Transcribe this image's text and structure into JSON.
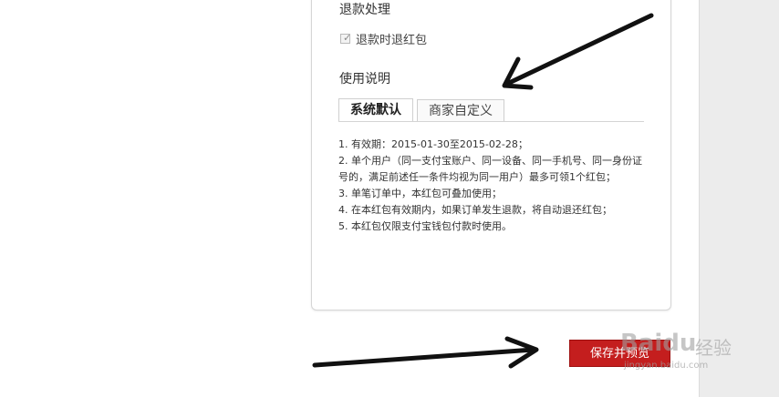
{
  "refund": {
    "title": "退款处理",
    "checkbox_label": "退款时退红包"
  },
  "usage": {
    "title": "使用说明",
    "tabs": [
      {
        "label": "系统默认"
      },
      {
        "label": "商家自定义"
      }
    ],
    "notes": [
      "1. 有效期：2015-01-30至2015-02-28；",
      "2. 单个用户（同一支付宝账户、同一设备、同一手机号、同一身份证号的，满足前述任一条件均视为同一用户）最多可领1个红包；",
      "3. 单笔订单中，本红包可叠加使用；",
      "4. 在本红包有效期内，如果订单发生退款，将自动退还红包；",
      "5. 本红包仅限支付宝钱包付款时使用。"
    ]
  },
  "actions": {
    "save_preview_label": "保存并预览"
  },
  "watermark": {
    "logo": "Baidu",
    "brand": "经验",
    "url": "jingyan.baidu.com"
  },
  "colors": {
    "button_bg": "#c41e1e",
    "sidebar_bg": "#ececec"
  }
}
